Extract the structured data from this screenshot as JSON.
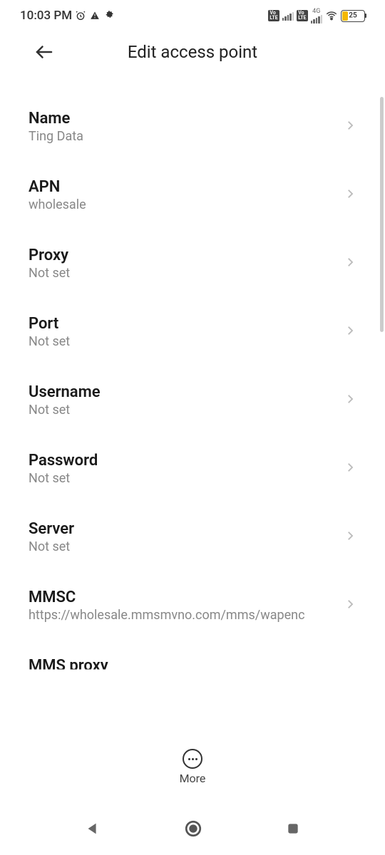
{
  "statusBar": {
    "time": "10:03 PM",
    "batteryPercent": "25"
  },
  "header": {
    "title": "Edit access point"
  },
  "settings": [
    {
      "label": "Name",
      "value": "Ting Data"
    },
    {
      "label": "APN",
      "value": "wholesale"
    },
    {
      "label": "Proxy",
      "value": "Not set"
    },
    {
      "label": "Port",
      "value": "Not set"
    },
    {
      "label": "Username",
      "value": "Not set"
    },
    {
      "label": "Password",
      "value": "Not set"
    },
    {
      "label": "Server",
      "value": "Not set"
    },
    {
      "label": "MMSC",
      "value": "https://wholesale.mmsmvno.com/mms/wapenc"
    },
    {
      "label": "MMS proxy",
      "value": ""
    }
  ],
  "bottomAction": {
    "moreLabel": "More"
  }
}
